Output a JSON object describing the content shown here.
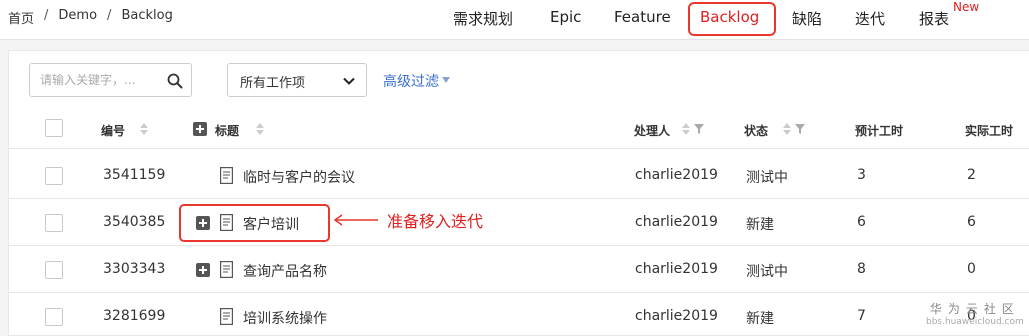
{
  "breadcrumb": [
    "首页",
    "Demo",
    "Backlog"
  ],
  "breadcrumb_sep": "/",
  "nav": {
    "items": [
      {
        "label": "需求规划"
      },
      {
        "label": "Epic"
      },
      {
        "label": "Feature"
      },
      {
        "label": "Backlog",
        "active": true
      },
      {
        "label": "缺陷"
      },
      {
        "label": "迭代"
      },
      {
        "label": "报表",
        "badge": "New"
      }
    ]
  },
  "filters": {
    "search_placeholder": "请输入关键字，...",
    "search_value": "",
    "workitem_select": "所有工作项",
    "advanced_filter": "高级过滤"
  },
  "table": {
    "headers": {
      "id": "编号",
      "title": "标题",
      "assignee": "处理人",
      "status": "状态",
      "planned_hours": "预计工时",
      "actual_hours": "实际工时"
    },
    "rows": [
      {
        "id": "3541159",
        "title": "临时与客户的会议",
        "has_children": false,
        "assignee": "charlie2019",
        "status": "测试中",
        "planned": "3",
        "actual": "2"
      },
      {
        "id": "3540385",
        "title": "客户培训",
        "has_children": true,
        "assignee": "charlie2019",
        "status": "新建",
        "planned": "6",
        "actual": "6"
      },
      {
        "id": "3303343",
        "title": "查询产品名称",
        "has_children": true,
        "assignee": "charlie2019",
        "status": "测试中",
        "planned": "8",
        "actual": "0"
      },
      {
        "id": "3281699",
        "title": "培训系统操作",
        "has_children": false,
        "assignee": "charlie2019",
        "status": "新建",
        "planned": "7",
        "actual": "0"
      }
    ]
  },
  "annotation": {
    "text": "准备移入迭代",
    "color": "#e02020"
  },
  "watermark": {
    "main": "华为云社区",
    "sub": "bbs.huaweicloud.com"
  },
  "colors": {
    "accent_red": "#e8372f",
    "link_blue": "#3b6fd1"
  }
}
